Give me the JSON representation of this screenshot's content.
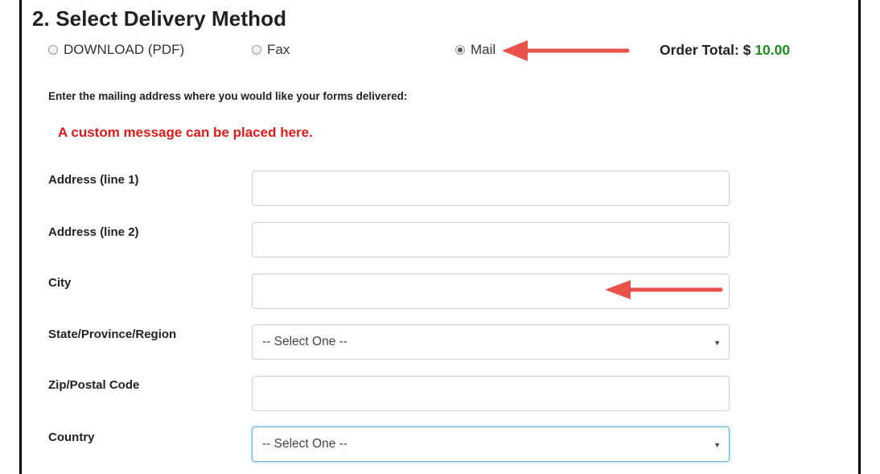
{
  "section": {
    "title": "2. Select Delivery Method"
  },
  "delivery_options": [
    {
      "label": "DOWNLOAD (PDF)",
      "checked": false
    },
    {
      "label": "Fax",
      "checked": false
    },
    {
      "label": "Mail",
      "checked": true
    }
  ],
  "order_total": {
    "label": "Order Total: $ ",
    "amount": "10.00",
    "amount_color": "#1e8e1e"
  },
  "instructions": "Enter the mailing address where you would like your forms delivered:",
  "custom_message": {
    "text": "A custom message can be placed here.",
    "color": "#e11a1a"
  },
  "fields": {
    "address1": {
      "label": "Address (line 1)",
      "value": ""
    },
    "address2": {
      "label": "Address (line 2)",
      "value": ""
    },
    "city": {
      "label": "City",
      "value": ""
    },
    "state": {
      "label": "State/Province/Region",
      "selected": "-- Select One --"
    },
    "zip": {
      "label": "Zip/Postal Code",
      "value": ""
    },
    "country": {
      "label": "Country",
      "selected": "-- Select One --"
    }
  },
  "annotations": {
    "arrow_color": "#e8524a"
  }
}
